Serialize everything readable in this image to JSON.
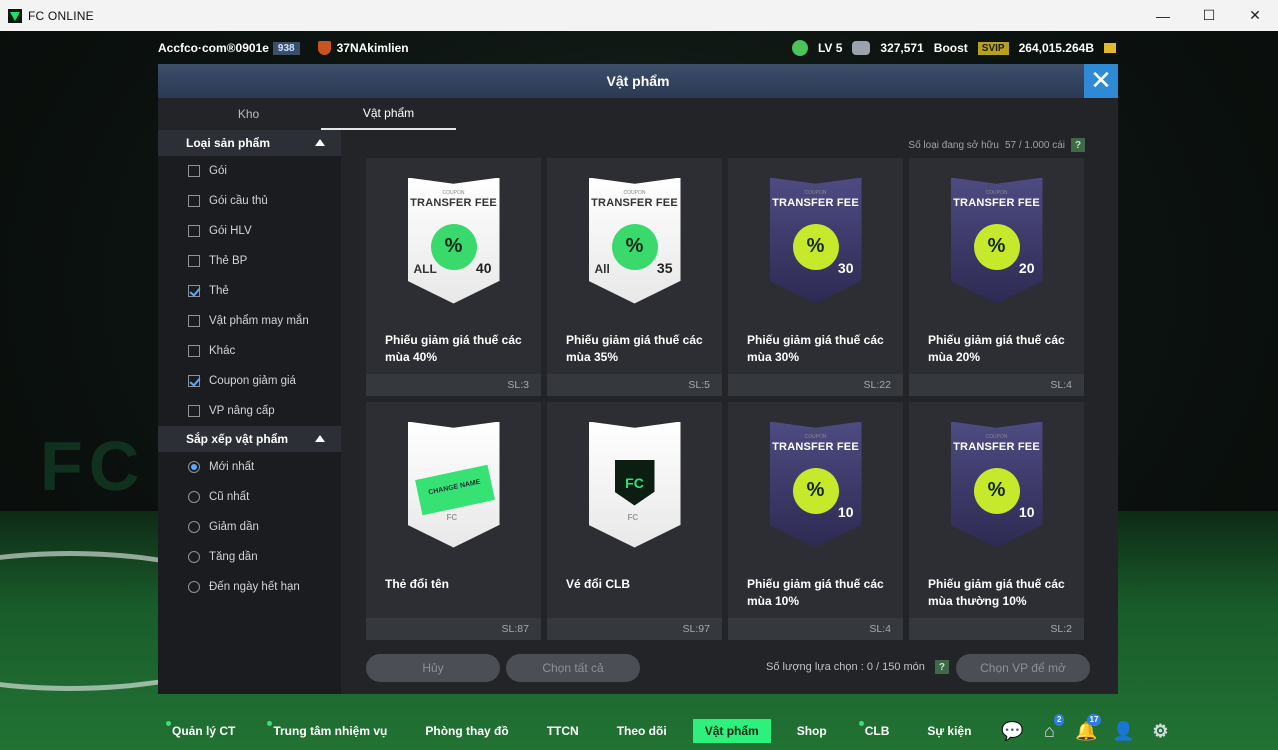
{
  "window": {
    "title": "FC ONLINE",
    "minimize": "—",
    "maximize": "☐",
    "close": "✕"
  },
  "hud": {
    "account": "Accfco·com®0901e",
    "account_badge": "938",
    "club": "37NAkimlien",
    "level": "LV 5",
    "points": "327,571",
    "boost": "Boost",
    "svip": "SVIP",
    "bp": "264,015.264B"
  },
  "panel": {
    "title": "Vật phẩm",
    "tabs": [
      "Kho",
      "Vật phẩm"
    ],
    "owned_label": "Số loại đang sở hữu",
    "owned_value": "57 / 1.000 cái",
    "help": "?",
    "filter": {
      "title": "Loại sản phẩm",
      "items": [
        {
          "label": "Gói",
          "checked": false
        },
        {
          "label": "Gói cầu thủ",
          "checked": false
        },
        {
          "label": "Gói HLV",
          "checked": false
        },
        {
          "label": "Thẻ BP",
          "checked": false
        },
        {
          "label": "Thẻ",
          "checked": true
        },
        {
          "label": "Vật phẩm may mắn",
          "checked": false
        },
        {
          "label": "Khác",
          "checked": false
        },
        {
          "label": "Coupon giảm giá",
          "checked": true
        },
        {
          "label": "VP nâng cấp",
          "checked": false
        }
      ]
    },
    "sort": {
      "title": "Sắp xếp vật phẩm",
      "items": [
        {
          "label": "Mới nhất",
          "selected": true
        },
        {
          "label": "Cũ nhất",
          "selected": false
        },
        {
          "label": "Giảm dần",
          "selected": false
        },
        {
          "label": "Tăng dần",
          "selected": false
        },
        {
          "label": "Đến ngày hết hạn",
          "selected": false
        }
      ]
    },
    "items": [
      {
        "name": "Phiếu giảm giá thuế các mùa 40%",
        "qty": "SL:3",
        "style": "white",
        "small": "COUPON",
        "title": "TRANSFER FEE",
        "pct": "40",
        "all": "ALL",
        "seal": "%"
      },
      {
        "name": "Phiếu giảm giá thuế các mùa 35%",
        "qty": "SL:5",
        "style": "white",
        "small": "COUPON",
        "title": "TRANSFER FEE",
        "pct": "35",
        "all": "All",
        "seal": "%"
      },
      {
        "name": "Phiếu giảm giá thuế các mùa 30%",
        "qty": "SL:22",
        "style": "purple",
        "small": "COUPON",
        "title": "TRANSFER FEE",
        "pct": "30",
        "all": "",
        "seal": "%"
      },
      {
        "name": "Phiếu giảm giá thuế các mùa 20%",
        "qty": "SL:4",
        "style": "purple",
        "small": "COUPON",
        "title": "TRANSFER FEE",
        "pct": "20",
        "all": "",
        "seal": "%"
      },
      {
        "name": "Thẻ đổi tên",
        "qty": "SL:87",
        "style": "rename",
        "sticker": "CHANGE NAME"
      },
      {
        "name": "Vé đổi CLB",
        "qty": "SL:97",
        "style": "club"
      },
      {
        "name": "Phiếu giảm giá thuế các mùa 10%",
        "qty": "SL:4",
        "style": "purple",
        "small": "COUPON",
        "title": "TRANSFER FEE",
        "pct": "10",
        "all": "",
        "seal": "%"
      },
      {
        "name": "Phiếu giảm giá thuế các mùa thường 10%",
        "qty": "SL:2",
        "style": "purple",
        "small": "COUPON",
        "title": "TRANSFER FEE",
        "pct": "10",
        "all": "",
        "seal": "%"
      }
    ],
    "btn_cancel": "Hủy",
    "btn_select_all": "Chọn tất cả",
    "selection_label": "Số lượng lựa chọn : 0 / 150 món",
    "btn_open": "Chọn VP để mở"
  },
  "nav": [
    {
      "label": "Quản lý CT",
      "dot": true,
      "active": false
    },
    {
      "label": "Trung tâm nhiệm vụ",
      "dot": true,
      "active": false
    },
    {
      "label": "Phòng thay đồ",
      "dot": false,
      "active": false
    },
    {
      "label": "TTCN",
      "dot": false,
      "active": false
    },
    {
      "label": "Theo dõi",
      "dot": false,
      "active": false
    },
    {
      "label": "Vật phẩm",
      "dot": false,
      "active": true
    },
    {
      "label": "Shop",
      "dot": false,
      "active": false
    },
    {
      "label": "CLB",
      "dot": true,
      "active": false
    },
    {
      "label": "Sự kiện",
      "dot": false,
      "active": false
    }
  ],
  "nav_icons": [
    {
      "name": "chat-icon",
      "glyph": "💬",
      "badge": ""
    },
    {
      "name": "home-icon",
      "glyph": "⌂",
      "badge": "2"
    },
    {
      "name": "bell-icon",
      "glyph": "🔔",
      "badge": "17"
    },
    {
      "name": "profile-icon",
      "glyph": "👤",
      "badge": ""
    },
    {
      "name": "settings-icon",
      "glyph": "⚙",
      "badge": ""
    }
  ]
}
